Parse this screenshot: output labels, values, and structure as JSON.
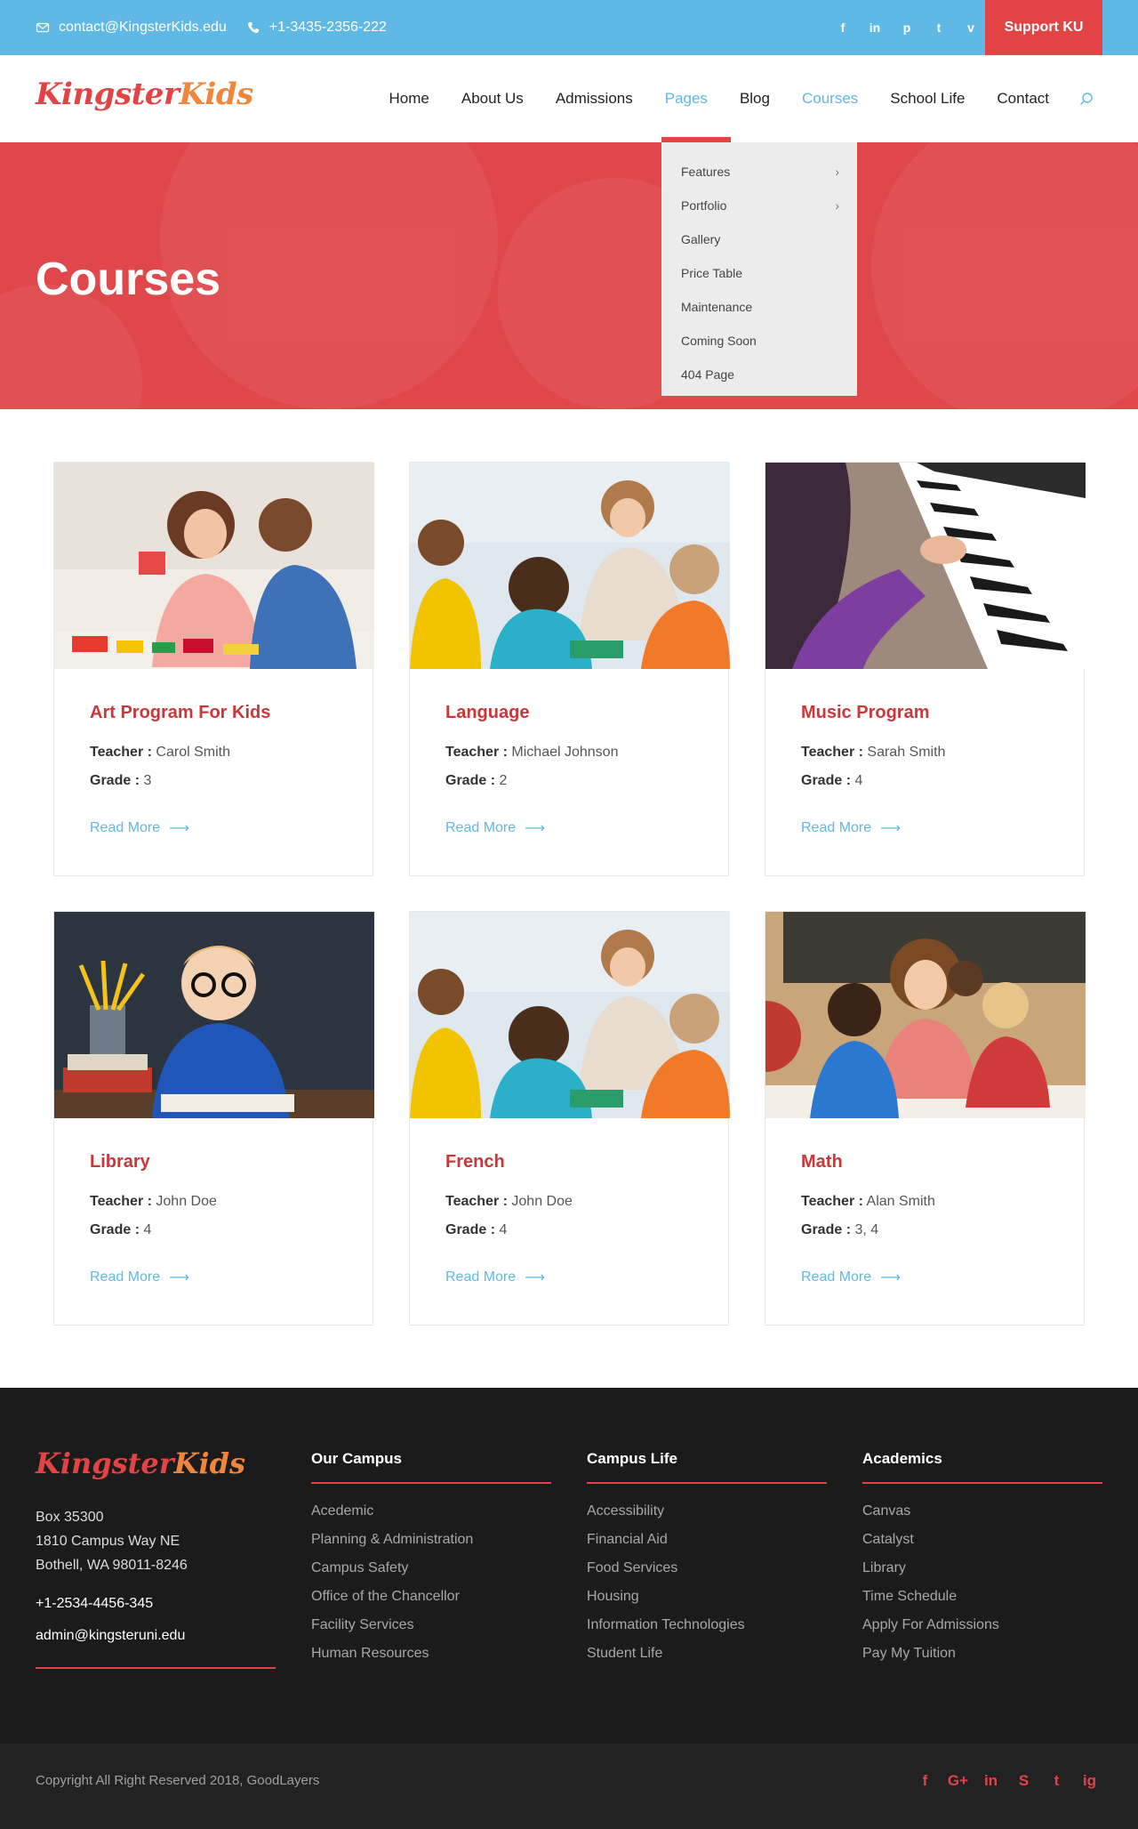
{
  "topbar": {
    "email": "contact@KingsterKids.edu",
    "phone": "+1-3435-2356-222",
    "social": [
      "f",
      "in",
      "p",
      "t",
      "v"
    ],
    "support_label": "Support KU"
  },
  "header": {
    "logo_part1": "Kingster",
    "logo_part2": "Kids",
    "nav": [
      "Home",
      "About Us",
      "Admissions",
      "Pages",
      "Blog",
      "Courses",
      "School Life",
      "Contact"
    ],
    "active_items": [
      "Pages",
      "Courses"
    ]
  },
  "dropdown": {
    "items": [
      "Features",
      "Portfolio",
      "Gallery",
      "Price Table",
      "Maintenance",
      "Coming Soon",
      "404 Page"
    ]
  },
  "hero": {
    "title": "Courses"
  },
  "labels": {
    "teacher": "Teacher :",
    "grade": "Grade :",
    "read_more": "Read More"
  },
  "courses": [
    {
      "title": "Art Program For Kids",
      "teacher": "Carol Smith",
      "grade": "3"
    },
    {
      "title": "Language",
      "teacher": "Michael Johnson",
      "grade": "2"
    },
    {
      "title": "Music Program",
      "teacher": "Sarah Smith",
      "grade": "4"
    },
    {
      "title": "Library",
      "teacher": "John Doe",
      "grade": "4"
    },
    {
      "title": "French",
      "teacher": "John Doe",
      "grade": "4"
    },
    {
      "title": "Math",
      "teacher": "Alan Smith",
      "grade": "3, 4"
    }
  ],
  "footer": {
    "logo_part1": "Kingster",
    "logo_part2": "Kids",
    "address_line1": "Box 35300",
    "address_line2": "1810 Campus Way NE",
    "address_line3": "Bothell, WA 98011-8246",
    "phone": "+1-2534-4456-345",
    "email": "admin@kingsteruni.edu",
    "columns": [
      {
        "title": "Our Campus",
        "links": [
          "Acedemic",
          "Planning & Administration",
          "Campus Safety",
          "Office of the Chancellor",
          "Facility Services",
          "Human Resources"
        ]
      },
      {
        "title": "Campus Life",
        "links": [
          "Accessibility",
          "Financial Aid",
          "Food Services",
          "Housing",
          "Information Technologies",
          "Student Life"
        ]
      },
      {
        "title": "Academics",
        "links": [
          "Canvas",
          "Catalyst",
          "Library",
          "Time Schedule",
          "Apply For Admissions",
          "Pay My Tuition"
        ]
      }
    ],
    "copyright": "Copyright All Right Reserved 2018, GoodLayers",
    "social": [
      "f",
      "G+",
      "in",
      "S",
      "t",
      "ig"
    ]
  },
  "colors": {
    "accent_blue": "#5fb9e4",
    "accent_red": "#e24446",
    "footer_bg": "#1b1b1b"
  }
}
